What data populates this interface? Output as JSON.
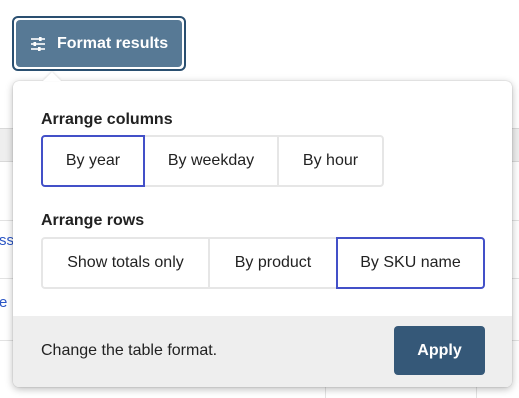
{
  "toolbar": {
    "format_label": "Format results",
    "format_icon": "sliders-icon"
  },
  "background": {
    "link_fragment_1": "ss",
    "link_fragment_2": "e"
  },
  "popover": {
    "columns": {
      "title": "Arrange columns",
      "options": [
        {
          "label": "By year",
          "selected": true
        },
        {
          "label": "By weekday",
          "selected": false
        },
        {
          "label": "By hour",
          "selected": false
        }
      ]
    },
    "rows": {
      "title": "Arrange rows",
      "options": [
        {
          "label": "Show totals only",
          "selected": false
        },
        {
          "label": "By product",
          "selected": false
        },
        {
          "label": "By SKU name",
          "selected": true
        }
      ]
    },
    "footer": {
      "description": "Change the table format.",
      "apply_label": "Apply"
    }
  },
  "colors": {
    "trigger_bg": "#577995",
    "trigger_focus_ring": "#2a4f70",
    "apply_bg": "#355878",
    "selected_border": "#4350c8",
    "link": "#2b56c5",
    "footer_bg": "#eeeeee"
  }
}
